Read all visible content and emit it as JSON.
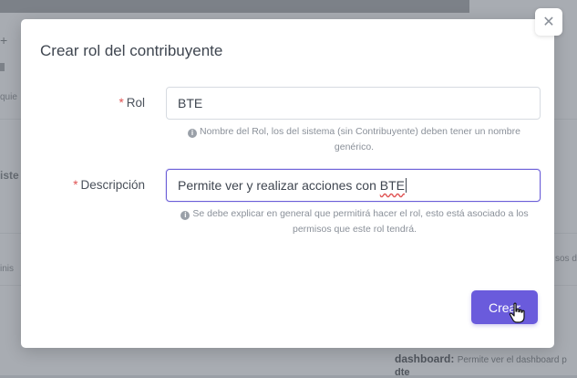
{
  "background": {
    "fragments": [
      "quie",
      "iste",
      "inis",
      "sos d"
    ],
    "dashboard_label": "dashboard:",
    "dashboard_desc": "Permite ver el dashboard p",
    "dashboard_line2": "dte"
  },
  "modal": {
    "title": "Crear rol del contribuyente",
    "close_symbol": "✕",
    "fields": {
      "rol": {
        "required_mark": "*",
        "label": "Rol",
        "value": "BTE",
        "help": "Nombre del Rol, los del sistema (sin Contribuyente) deben tener un nombre genérico."
      },
      "descripcion": {
        "required_mark": "*",
        "label": "Descripción",
        "value_prefix": "Permite ver y realizar acciones con ",
        "value_misspelled": "BTE",
        "help": "Se debe explicar en general que permitirá hacer el rol, esto está asociado a los permisos que este rol tendrá."
      }
    },
    "info_symbol": "i",
    "submit_label": "Crear"
  },
  "colors": {
    "primary": "#6a5bdc",
    "required": "#e05454",
    "help_text": "#8a9099"
  }
}
